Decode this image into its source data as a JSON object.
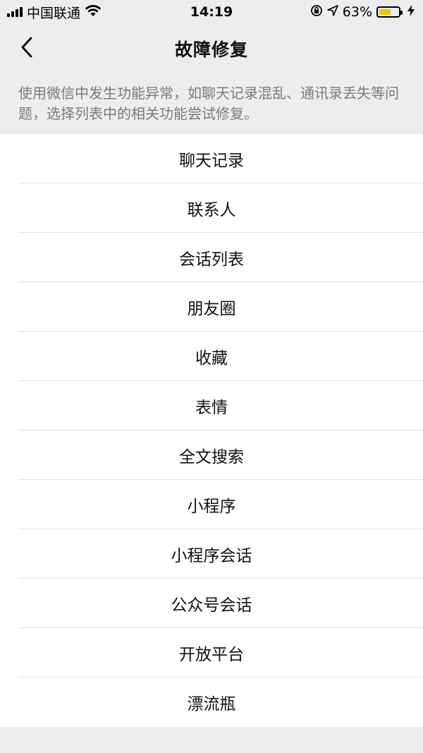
{
  "status_bar": {
    "carrier": "中国联通",
    "time": "14:19",
    "battery_percent": "63%",
    "battery_level": 0.63,
    "colors": {
      "battery_fill": "#f3c600"
    },
    "icons": [
      "signal-icon",
      "wifi-icon",
      "rotation-lock-icon",
      "location-icon",
      "battery-icon",
      "charging-icon"
    ]
  },
  "nav": {
    "title": "故障修复",
    "back_icon": "chevron-left-icon"
  },
  "description": "使用微信中发生功能异常，如聊天记录混乱、通讯录丢失等问题，选择列表中的相关功能尝试修复。",
  "items": [
    {
      "label": "聊天记录"
    },
    {
      "label": "联系人"
    },
    {
      "label": "会话列表"
    },
    {
      "label": "朋友圈"
    },
    {
      "label": "收藏"
    },
    {
      "label": "表情"
    },
    {
      "label": "全文搜索"
    },
    {
      "label": "小程序"
    },
    {
      "label": "小程序会话"
    },
    {
      "label": "公众号会话"
    },
    {
      "label": "开放平台"
    },
    {
      "label": "漂流瓶"
    }
  ]
}
